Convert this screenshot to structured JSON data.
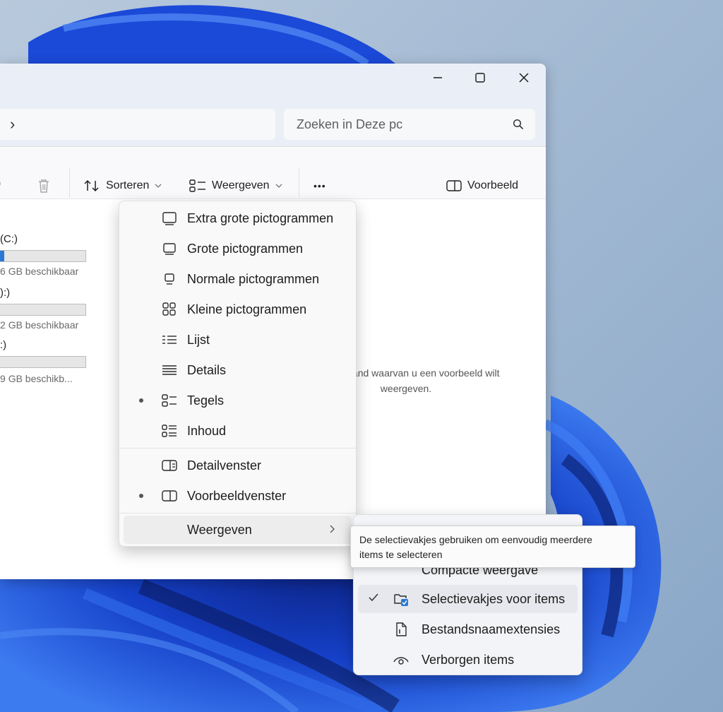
{
  "window": {
    "minimize_icon": "minimize-icon",
    "maximize_icon": "maximize-icon",
    "close_icon": "close-icon"
  },
  "address": {
    "chevron": "›",
    "search_placeholder": "Zoeken in Deze pc"
  },
  "toolbar": {
    "sort_label": "Sorteren",
    "view_label": "Weergeven",
    "more_label": "•••",
    "preview_label": "Voorbeeld"
  },
  "drives": [
    {
      "label": "(C:)",
      "free_text": "GB beschikbaar",
      "free_prefix": "6",
      "used_fraction": 0.06
    },
    {
      "label": "):)",
      "free_text": "GB beschikbaar",
      "free_prefix": "2",
      "used_fraction": 0.0
    },
    {
      "label": ":)",
      "free_text": "GB beschikb...",
      "free_prefix": "9",
      "used_fraction": 0.0
    }
  ],
  "preview_message": {
    "line1": "bestand waarvan u een voorbeeld wilt",
    "line2": "weergeven."
  },
  "view_menu": {
    "items": [
      {
        "label": "Extra grote pictogrammen",
        "icon": "extra-large-icons-icon",
        "active": false
      },
      {
        "label": "Grote pictogrammen",
        "icon": "large-icons-icon",
        "active": false
      },
      {
        "label": "Normale pictogrammen",
        "icon": "medium-icons-icon",
        "active": false
      },
      {
        "label": "Kleine pictogrammen",
        "icon": "small-icons-icon",
        "active": false
      },
      {
        "label": "Lijst",
        "icon": "list-icon",
        "active": false
      },
      {
        "label": "Details",
        "icon": "details-icon",
        "active": false
      },
      {
        "label": "Tegels",
        "icon": "tiles-icon",
        "active": true
      },
      {
        "label": "Inhoud",
        "icon": "content-icon",
        "active": false
      }
    ],
    "panes": [
      {
        "label": "Detailvenster",
        "icon": "details-pane-icon",
        "active": false
      },
      {
        "label": "Voorbeeldvenster",
        "icon": "preview-pane-icon",
        "active": true
      }
    ],
    "show_label": "Weergeven"
  },
  "sub_menu": {
    "hidden_item_fragment": "Compacte weergave",
    "items": [
      {
        "label": "Selectievakjes voor items",
        "icon": "checkbox-folder-icon",
        "checked": true
      },
      {
        "label": "Bestandsnaamextensies",
        "icon": "file-extension-icon",
        "checked": false
      },
      {
        "label": "Verborgen items",
        "icon": "eye-icon",
        "checked": false
      }
    ]
  },
  "tooltip": {
    "line1": "De selectievakjes gebruiken om eenvoudig meerdere",
    "line2": "items te selecteren"
  },
  "colors": {
    "accent": "#2a78d4",
    "wallpaper_blue": "#1e4fd6",
    "titlebar": "#eaeff7"
  }
}
